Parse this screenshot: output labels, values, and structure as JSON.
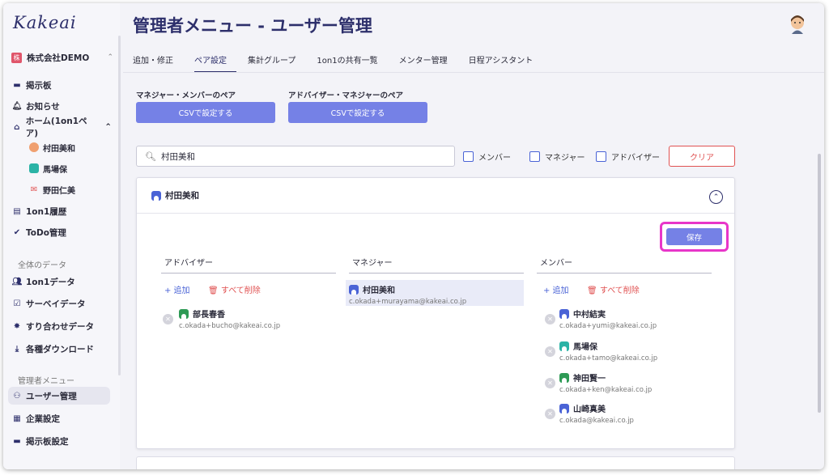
{
  "app": {
    "logo": "Kakeai",
    "company": "株式会社DEMO",
    "company_badge": "株"
  },
  "sidebar": {
    "items": [
      {
        "label": "掲示板",
        "icon": "board-icon"
      },
      {
        "label": "お知らせ",
        "icon": "bell-icon"
      },
      {
        "label": "ホーム(1on1ペア)",
        "icon": "home-icon"
      },
      {
        "label": "1on1履歴",
        "icon": "history-icon"
      },
      {
        "label": "ToDo管理",
        "icon": "check-circle-icon"
      },
      {
        "label": "1on1データ",
        "icon": "people-icon"
      },
      {
        "label": "サーベイデータ",
        "icon": "survey-icon"
      },
      {
        "label": "すり合わせデータ",
        "icon": "star-icon"
      },
      {
        "label": "各種ダウンロード",
        "icon": "download-icon"
      },
      {
        "label": "ユーザー管理",
        "icon": "user-manage-icon"
      },
      {
        "label": "企業設定",
        "icon": "company-icon"
      },
      {
        "label": "掲示板設定",
        "icon": "board-settings-icon"
      }
    ],
    "home_children": [
      "村田美和",
      "馬場保",
      "野田仁美"
    ],
    "sections": {
      "data": "全体のデータ",
      "admin": "管理者メニュー"
    },
    "chevron": "^"
  },
  "header": {
    "title": "管理者メニュー - ユーザー管理"
  },
  "tabs": [
    "追加・修正",
    "ペア設定",
    "集計グループ",
    "1on1の共有一覧",
    "メンター管理",
    "日程アシスタント"
  ],
  "csv": {
    "mm_label": "マネジャー・メンバーのペア",
    "am_label": "アドバイザー・マネジャーのペア",
    "button": "CSVで設定する"
  },
  "search": {
    "value": "村田美和",
    "icon": "search-icon"
  },
  "filters": {
    "member": "メンバー",
    "manager": "マネジャー",
    "advisor": "アドバイザー",
    "clear": "クリア"
  },
  "panel": {
    "title": "村田美和",
    "save": "保存",
    "add": "+ 追加",
    "delete_all": "すべて削除",
    "advisor": {
      "header": "アドバイザー",
      "entries": [
        {
          "name": "部長春香",
          "email": "c.okada+bucho@kakeai.co.jp"
        }
      ]
    },
    "manager": {
      "header": "マネジャー",
      "name": "村田美和",
      "email": "c.okada+murayama@kakeai.co.jp"
    },
    "member": {
      "header": "メンバー",
      "entries": [
        {
          "name": "中村結実",
          "email": "c.okada+yumi@kakeai.co.jp"
        },
        {
          "name": "馬場保",
          "email": "c.okada+tamo@kakeai.co.jp"
        },
        {
          "name": "神田賢一",
          "email": "c.okada+ken@kakeai.co.jp"
        },
        {
          "name": "山崎真美",
          "email": "c.okada@kakeai.co.jp"
        }
      ]
    }
  },
  "colors": {
    "brand": "#2d2f6b",
    "button": "#7581e6",
    "danger": "#e05252",
    "highlight": "#e836c9"
  }
}
